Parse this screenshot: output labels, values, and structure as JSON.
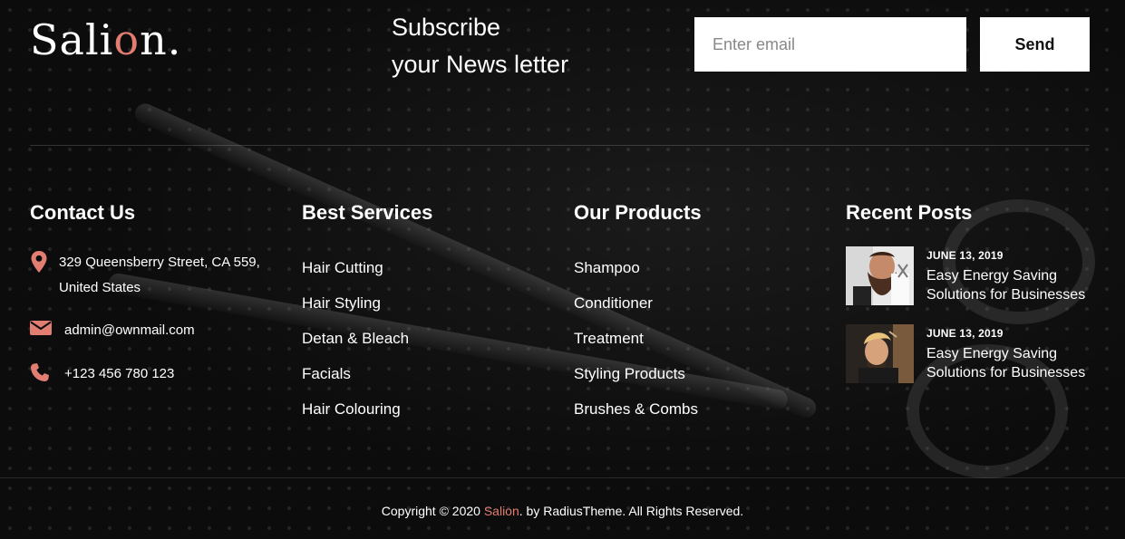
{
  "logo": {
    "prefix": "Sali",
    "accent": "o",
    "suffix": "n."
  },
  "newsletter": {
    "title_line1": "Subscribe",
    "title_line2": "your News letter",
    "email_placeholder": "Enter email",
    "send_label": "Send"
  },
  "contact": {
    "heading": "Contact Us",
    "address": "329 Queensberry Street, CA 559, United States",
    "email": "admin@ownmail.com",
    "phone": "+123 456 780 123"
  },
  "services": {
    "heading": "Best Services",
    "items": [
      "Hair Cutting",
      "Hair Styling",
      "Detan & Bleach",
      "Facials",
      "Hair Colouring"
    ]
  },
  "products": {
    "heading": "Our Products",
    "items": [
      "Shampoo",
      "Conditioner",
      "Treatment",
      "Styling Products",
      "Brushes & Combs"
    ]
  },
  "posts": {
    "heading": "Recent Posts",
    "items": [
      {
        "date": "JUNE 13, 2019",
        "title": "Easy Energy Saving Solutions for Businesses"
      },
      {
        "date": "JUNE 13, 2019",
        "title": "Easy Energy Saving Solutions for Businesses"
      }
    ]
  },
  "footer": {
    "copyright_prefix": "Copyright © 2020 ",
    "brand": "Salion",
    "copyright_suffix": ". by RadiusTheme. All Rights Reserved."
  },
  "colors": {
    "accent": "#e27d72",
    "background": "#0b0b0b",
    "text": "#ffffff"
  },
  "icons": {
    "address": "map-pin-icon",
    "email": "envelope-icon",
    "phone": "phone-icon"
  }
}
